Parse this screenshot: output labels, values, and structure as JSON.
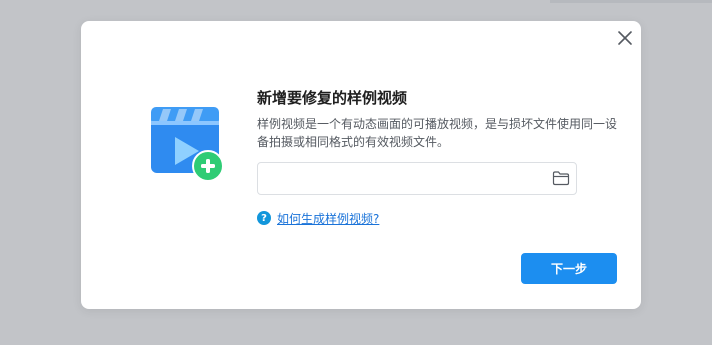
{
  "dialog": {
    "title": "新增要修复的样例视频",
    "description": "样例视频是一个有动态画面的可播放视频，是与损坏文件使用同一设备拍摄或相同格式的有效视频文件。",
    "file_input": {
      "value": "",
      "placeholder": ""
    },
    "help_link": "如何生成样例视频?",
    "help_icon_glyph": "?",
    "next_button": "下一步"
  },
  "colors": {
    "primary": "#1c8ef0",
    "link": "#1a73d9",
    "add_badge": "#2fcc75",
    "overlay": "#c2c4c8"
  },
  "icons": {
    "close": "close-icon",
    "folder": "folder-icon",
    "help": "question-circle-icon",
    "illustration": "video-add-icon"
  }
}
